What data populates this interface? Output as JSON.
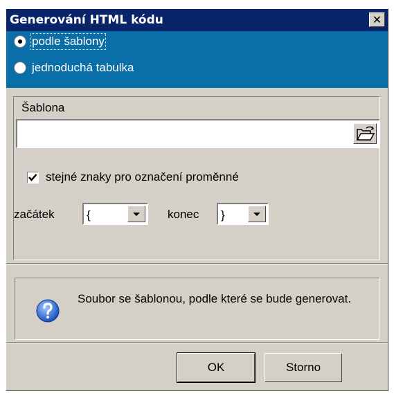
{
  "window": {
    "title": "Generování HTML kódu",
    "close_glyph": "✕"
  },
  "mode": {
    "options": [
      {
        "label": "podle šablony",
        "selected": true
      },
      {
        "label": "jednoduchá tabulka",
        "selected": false
      }
    ]
  },
  "template_group": {
    "label": "Šablona",
    "file_path": {
      "value": "",
      "placeholder": ""
    },
    "browse_icon": "open-folder-icon",
    "same_chars": {
      "label": "stejné znaky pro označení proměnné",
      "checked": true
    },
    "start": {
      "label": "začátek",
      "value": "{"
    },
    "end": {
      "label": "konec",
      "value": "}"
    }
  },
  "info": {
    "icon": "help-icon",
    "text": "Soubor se šablonou,  podle které se bude generovat."
  },
  "buttons": {
    "ok": "OK",
    "cancel": "Storno"
  },
  "colors": {
    "title_bar": "#0a246a",
    "mode_bar": "#0a6ea8",
    "dialog_bg": "#d4d0c8"
  }
}
